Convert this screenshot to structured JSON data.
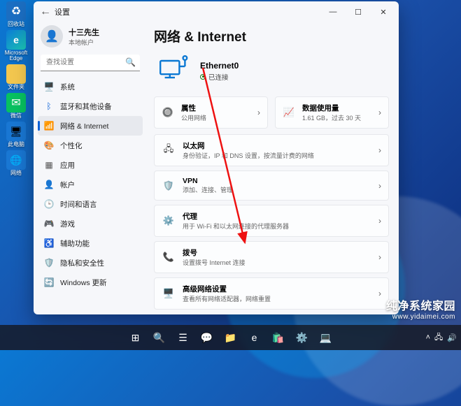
{
  "desktop": {
    "items": [
      {
        "label": "回收站",
        "icon": "recycle-bin-icon",
        "cls": "di-recycle"
      },
      {
        "label": "Microsoft Edge",
        "icon": "edge-icon",
        "cls": "di-edge"
      },
      {
        "label": "文件夹",
        "icon": "folder-icon",
        "cls": "di-folder"
      },
      {
        "label": "微信",
        "icon": "wechat-icon",
        "cls": "di-wechat"
      },
      {
        "label": "此电脑",
        "icon": "this-pc-icon",
        "cls": "di-thispc"
      },
      {
        "label": "网络",
        "icon": "network-icon",
        "cls": "di-net"
      }
    ]
  },
  "window": {
    "app_name": "设置",
    "back_glyph": "←",
    "min_glyph": "—",
    "max_glyph": "☐",
    "close_glyph": "✕"
  },
  "account": {
    "name": "十三先生",
    "subtitle": "本地帐户",
    "avatar_glyph": "👤"
  },
  "search": {
    "placeholder": "查找设置",
    "icon_glyph": "🔍"
  },
  "nav": {
    "items": [
      {
        "icon": "🖥️",
        "label": "系统",
        "name": "sidebar-item-system",
        "color": "#0b61d6"
      },
      {
        "icon": "ᛒ",
        "label": "蓝牙和其他设备",
        "name": "sidebar-item-bluetooth",
        "color": "#0b61d6"
      },
      {
        "icon": "📶",
        "label": "网络 & Internet",
        "name": "sidebar-item-network",
        "color": "#0b61d6",
        "active": true
      },
      {
        "icon": "🎨",
        "label": "个性化",
        "name": "sidebar-item-personalization",
        "color": "#d53a9d"
      },
      {
        "icon": "▦",
        "label": "应用",
        "name": "sidebar-item-apps",
        "color": "#555"
      },
      {
        "icon": "👤",
        "label": "帐户",
        "name": "sidebar-item-accounts",
        "color": "#e06c00"
      },
      {
        "icon": "🕒",
        "label": "时间和语言",
        "name": "sidebar-item-time-language",
        "color": "#0aa3a3"
      },
      {
        "icon": "🎮",
        "label": "游戏",
        "name": "sidebar-item-gaming",
        "color": "#555"
      },
      {
        "icon": "♿",
        "label": "辅助功能",
        "name": "sidebar-item-accessibility",
        "color": "#0b61d6"
      },
      {
        "icon": "🛡️",
        "label": "隐私和安全性",
        "name": "sidebar-item-privacy",
        "color": "#0b61d6"
      },
      {
        "icon": "🔄",
        "label": "Windows 更新",
        "name": "sidebar-item-windows-update",
        "color": "#0b61d6"
      }
    ]
  },
  "page": {
    "title": "网络 & Internet",
    "status": {
      "adapter_name": "Ethernet0",
      "state": "已连接"
    },
    "tiles": [
      {
        "icon": "🔘",
        "heading": "属性",
        "sub": "公用网络",
        "name": "tile-properties"
      },
      {
        "icon": "📈",
        "heading": "数据使用量",
        "sub": "1.61 GB，过去 30 天",
        "name": "tile-data-usage"
      }
    ],
    "rows": [
      {
        "icon": "🖧",
        "heading": "以太网",
        "sub": "身份验证，IP 和 DNS 设置，按流量计费的网络",
        "name": "row-ethernet"
      },
      {
        "icon": "🛡️",
        "heading": "VPN",
        "sub": "添加、连接、管理",
        "name": "row-vpn"
      },
      {
        "icon": "⚙️",
        "heading": "代理",
        "sub": "用于 Wi-Fi 和以太网连接的代理服务器",
        "name": "row-proxy"
      },
      {
        "icon": "📞",
        "heading": "拨号",
        "sub": "设置拨号 Internet 连接",
        "name": "row-dialup"
      },
      {
        "icon": "🖥️",
        "heading": "高级网络设置",
        "sub": "查看所有网络适配器，网络重置",
        "name": "row-advanced"
      }
    ],
    "chevron_glyph": "›"
  },
  "taskbar": {
    "items": [
      {
        "icon": "⊞",
        "name": "tb-start"
      },
      {
        "icon": "🔍",
        "name": "tb-search"
      },
      {
        "icon": "☰",
        "name": "tb-taskview"
      },
      {
        "icon": "💬",
        "name": "tb-chat"
      },
      {
        "icon": "📁",
        "name": "tb-explorer"
      },
      {
        "icon": "e",
        "name": "tb-edge"
      },
      {
        "icon": "🛍️",
        "name": "tb-store"
      },
      {
        "icon": "⚙️",
        "name": "tb-settings"
      },
      {
        "icon": "💻",
        "name": "tb-app"
      }
    ],
    "sys": {
      "up_glyph": "˄",
      "net_glyph": "🖧",
      "vol_glyph": "🔊"
    }
  },
  "watermark": {
    "brand": "纯净系统家园",
    "url": "www.yidaimei.com"
  },
  "colors": {
    "accent": "#0b61d6",
    "connected": "#107c10"
  }
}
